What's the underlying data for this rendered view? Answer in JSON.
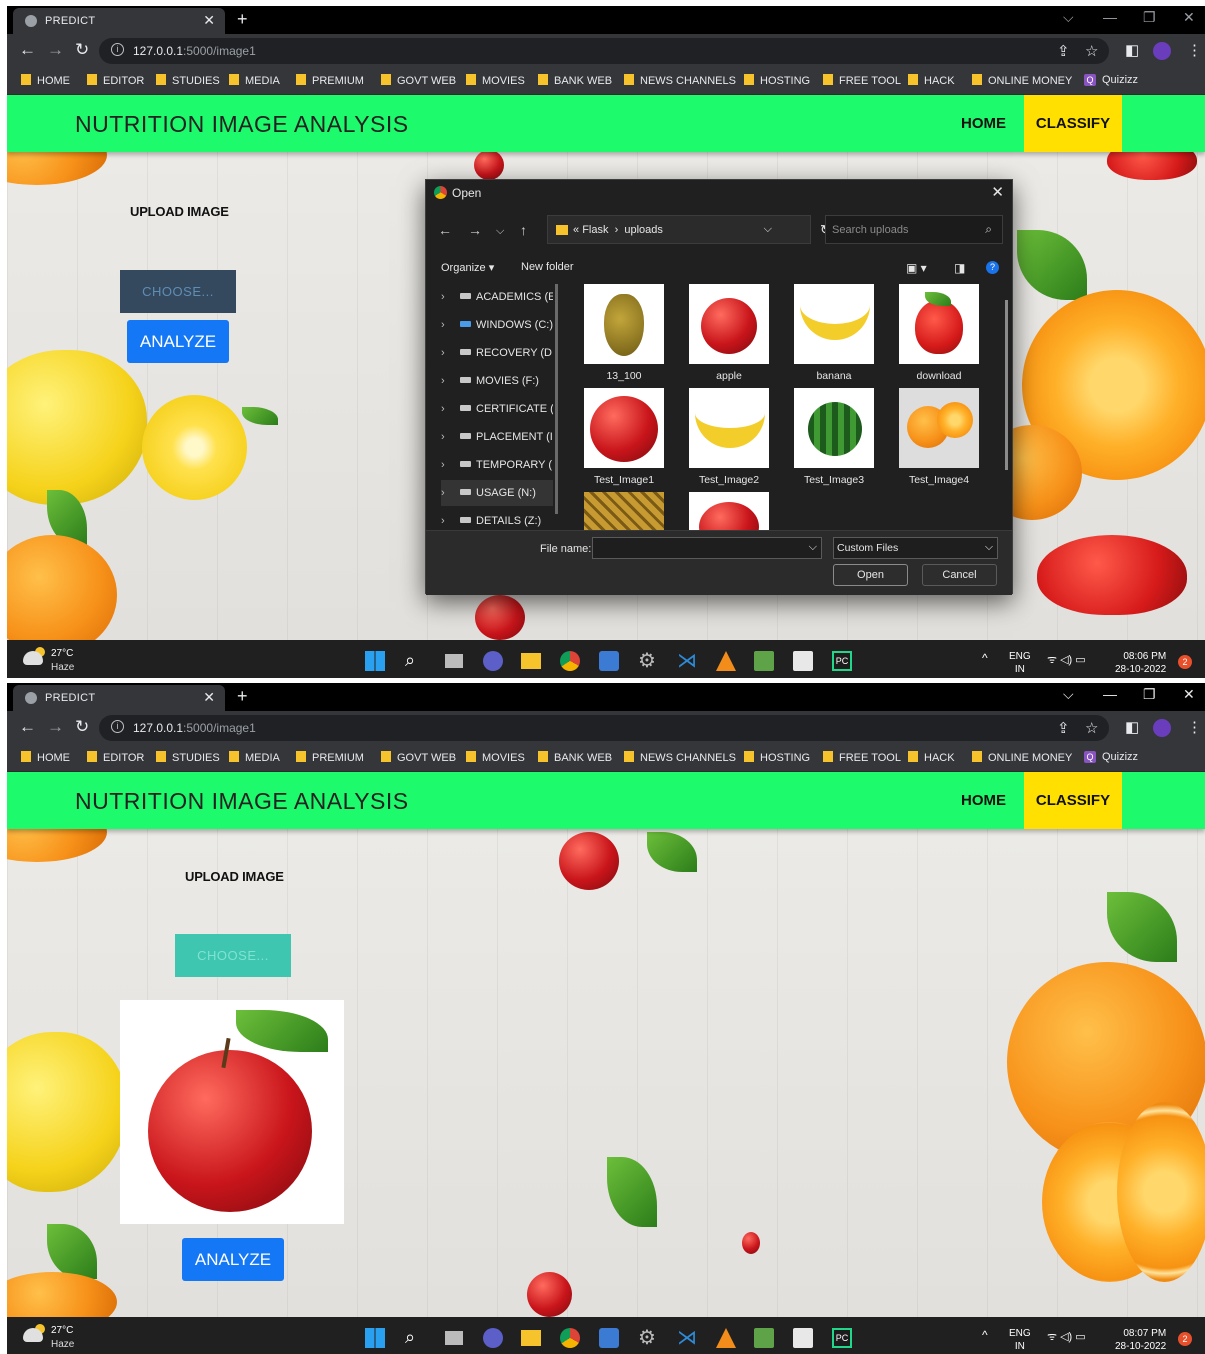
{
  "browser": {
    "tab_title": "PREDICT",
    "new_tab": "+",
    "url_host": "127.0.0.1",
    "url_path": ":5000/image1",
    "bookmarks": [
      "HOME",
      "EDITOR",
      "STUDIES",
      "MEDIA",
      "PREMIUM",
      "GOVT WEB",
      "MOVIES",
      "BANK WEB",
      "NEWS CHANNELS",
      "HOSTING",
      "FREE TOOL",
      "HACK",
      "ONLINE MONEY",
      "Quizizz"
    ]
  },
  "site": {
    "brand": "NUTRITION IMAGE ANALYSIS",
    "nav_home": "HOME",
    "nav_classify": "CLASSIFY",
    "upload_title": "UPLOAD IMAGE",
    "choose_label": "CHOOSE...",
    "analyze_label": "ANALYZE"
  },
  "dialog": {
    "title": "Open",
    "path": [
      "Flask",
      "uploads"
    ],
    "search_placeholder": "Search uploads",
    "organize": "Organize ▾",
    "new_folder": "New folder",
    "drives": [
      "ACADEMICS (E",
      "WINDOWS (C:)",
      "RECOVERY (D:)",
      "MOVIES (F:)",
      "CERTIFICATE (",
      "PLACEMENT (I",
      "TEMPORARY (",
      "USAGE (N:)",
      "DETAILS (Z:)"
    ],
    "files": [
      "13_100",
      "apple",
      "banana",
      "download",
      "Test_Image1",
      "Test_Image2",
      "Test_Image3",
      "Test_Image4"
    ],
    "file_name_label": "File name:",
    "file_type": "Custom Files",
    "open_label": "Open",
    "cancel_label": "Cancel"
  },
  "taskbar": {
    "temp": "27°C",
    "condition": "Haze",
    "lang": "ENG",
    "region": "IN",
    "time1": "08:06 PM",
    "time2": "08:07 PM",
    "date": "28-10-2022",
    "badge": "2"
  },
  "colors": {
    "nav_green": "#1dfa6c",
    "classify_yellow": "#ffe000",
    "analyze_blue": "#1477f5",
    "choose_dark": "#34495e",
    "choose_teal": "#3fc6b0"
  }
}
